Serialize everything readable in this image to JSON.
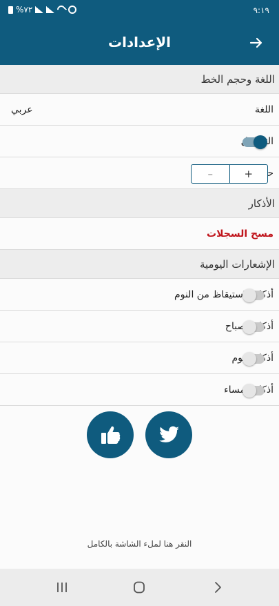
{
  "status_bar": {
    "time": "٩:١٩",
    "battery_text": "%٧٢"
  },
  "header": {
    "title": "الإعدادات",
    "back_icon": "arrow-right-icon"
  },
  "sections": {
    "font": {
      "title": "اللغة وحجم الخط",
      "language_label": "اللغة",
      "language_value": "عربي",
      "diacritics_label": "التشكيل",
      "diacritics_on": true,
      "font_size_label": "حجم الخط",
      "plus": "+",
      "minus": "–"
    },
    "azkar": {
      "title": "الأذكار",
      "clear_logs": "مسح السجلات"
    },
    "notifications": {
      "title": "الإشعارات اليومية",
      "items": [
        {
          "label": "أذكار الاستيقاظ من النوم",
          "enabled": false
        },
        {
          "label": "أذكار الصباح",
          "enabled": false
        },
        {
          "label": "أذكار النوم",
          "enabled": false
        },
        {
          "label": "أذكار المساء",
          "enabled": false
        }
      ]
    }
  },
  "social": {
    "twitter_icon": "twitter-icon",
    "like_icon": "thumbs-up-icon"
  },
  "fullscreen_hint": "النقر هنا لملء الشاشة بالكامل",
  "colors": {
    "primary": "#0f5b7e",
    "danger": "#c0141b"
  }
}
